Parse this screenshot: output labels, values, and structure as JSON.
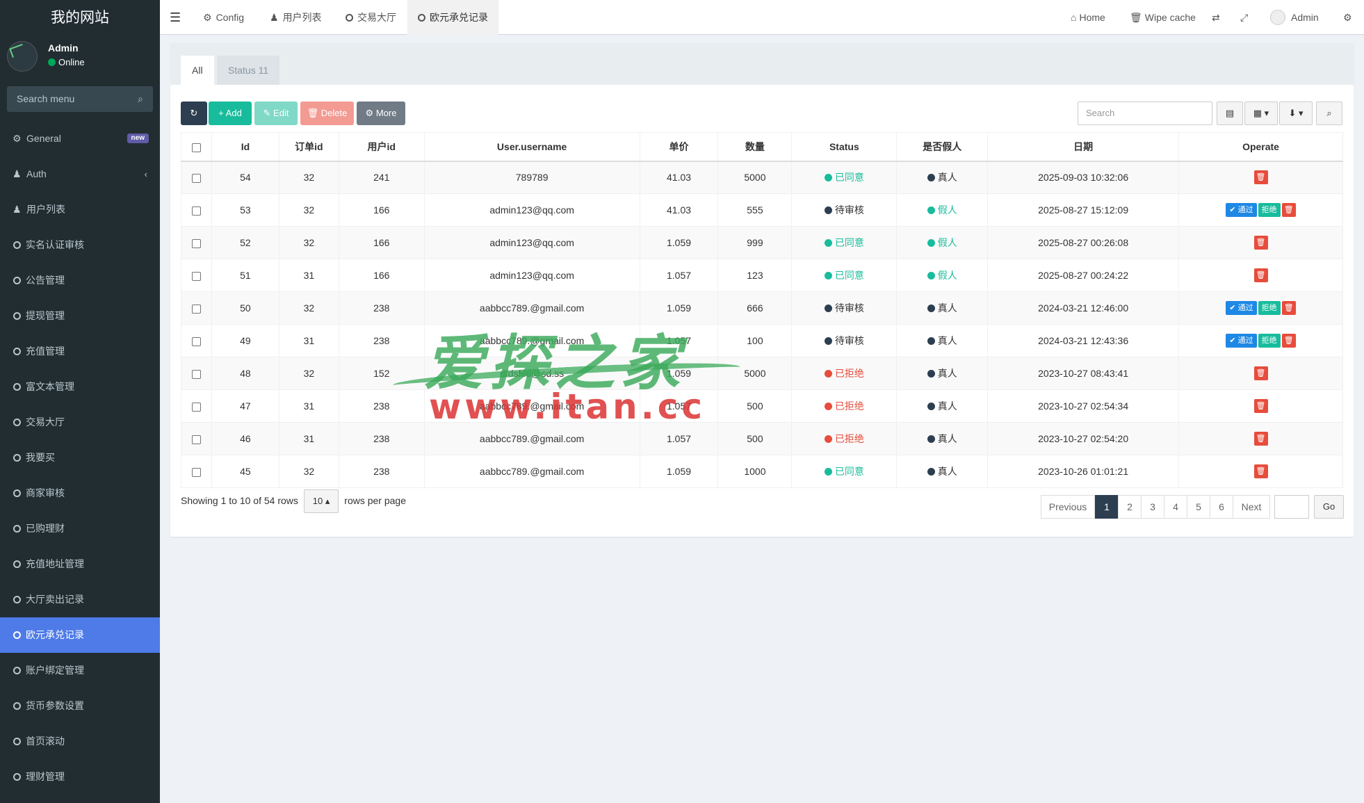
{
  "site_title": "我的网站",
  "user": {
    "name": "Admin",
    "status": "Online"
  },
  "sidebar": {
    "search_placeholder": "Search menu",
    "items": [
      {
        "label": "General",
        "icon": "cogs-icon",
        "badge": "new"
      },
      {
        "label": "Auth",
        "icon": "group-icon"
      },
      {
        "label": "用户列表",
        "icon": "user-icon"
      },
      {
        "label": "实名认证审核",
        "icon": "circle-icon"
      },
      {
        "label": "公告管理",
        "icon": "circle-icon"
      },
      {
        "label": "提现管理",
        "icon": "circle-icon"
      },
      {
        "label": "充值管理",
        "icon": "circle-icon"
      },
      {
        "label": "富文本管理",
        "icon": "circle-icon"
      },
      {
        "label": "交易大厅",
        "icon": "circle-icon"
      },
      {
        "label": "我要买",
        "icon": "circle-icon"
      },
      {
        "label": "商家审核",
        "icon": "circle-icon"
      },
      {
        "label": "已购理财",
        "icon": "circle-icon"
      },
      {
        "label": "充值地址管理",
        "icon": "circle-icon"
      },
      {
        "label": "大厅卖出记录",
        "icon": "circle-icon"
      },
      {
        "label": "欧元承兑记录",
        "icon": "circle-icon",
        "active": true
      },
      {
        "label": "账户绑定管理",
        "icon": "circle-icon"
      },
      {
        "label": "货币参数设置",
        "icon": "circle-icon"
      },
      {
        "label": "首页滚动",
        "icon": "circle-icon"
      },
      {
        "label": "理财管理",
        "icon": "circle-icon"
      }
    ]
  },
  "header": {
    "tabs": [
      {
        "label": "Config",
        "icon": "gear-icon"
      },
      {
        "label": "用户列表",
        "icon": "user-icon"
      },
      {
        "label": "交易大厅",
        "icon": "circle-icon"
      },
      {
        "label": "欧元承兑记录",
        "icon": "circle-icon",
        "active": true
      }
    ],
    "home": "Home",
    "wipe_cache": "Wipe cache",
    "admin": "Admin"
  },
  "panel_tabs": {
    "all": "All",
    "status": "Status 11"
  },
  "toolbar": {
    "add": "Add",
    "edit": "Edit",
    "delete": "Delete",
    "more": "More",
    "search_placeholder": "Search"
  },
  "table": {
    "columns": [
      "Id",
      "订单id",
      "用户id",
      "User.username",
      "单价",
      "数量",
      "Status",
      "是否假人",
      "日期",
      "Operate"
    ],
    "rows": [
      {
        "id": "54",
        "order": "32",
        "uid": "241",
        "username": "789789",
        "price": "41.03",
        "qty": "5000",
        "status": "已同意",
        "status_type": "green",
        "fake": "真人",
        "fake_type": "dark",
        "date": "2025-09-03 10:32:06",
        "ops": false
      },
      {
        "id": "53",
        "order": "32",
        "uid": "166",
        "username": "admin123@qq.com",
        "price": "41.03",
        "qty": "555",
        "status": "待审核",
        "status_type": "dark",
        "fake": "假人",
        "fake_type": "green",
        "date": "2025-08-27 15:12:09",
        "ops": true
      },
      {
        "id": "52",
        "order": "32",
        "uid": "166",
        "username": "admin123@qq.com",
        "price": "1.059",
        "qty": "999",
        "status": "已同意",
        "status_type": "green",
        "fake": "假人",
        "fake_type": "green",
        "date": "2025-08-27 00:26:08",
        "ops": false
      },
      {
        "id": "51",
        "order": "31",
        "uid": "166",
        "username": "admin123@qq.com",
        "price": "1.057",
        "qty": "123",
        "status": "已同意",
        "status_type": "green",
        "fake": "假人",
        "fake_type": "green",
        "date": "2025-08-27 00:24:22",
        "ops": false
      },
      {
        "id": "50",
        "order": "32",
        "uid": "238",
        "username": "aabbcc789.@gmail.com",
        "price": "1.059",
        "qty": "666",
        "status": "待审核",
        "status_type": "dark",
        "fake": "真人",
        "fake_type": "dark",
        "date": "2024-03-21 12:46:00",
        "ops": true
      },
      {
        "id": "49",
        "order": "31",
        "uid": "238",
        "username": "aabbcc789.@gmail.com",
        "price": "1.057",
        "qty": "100",
        "status": "待审核",
        "status_type": "dark",
        "fake": "真人",
        "fake_type": "dark",
        "date": "2024-03-21 12:43:36",
        "ops": true
      },
      {
        "id": "48",
        "order": "32",
        "uid": "152",
        "username": "dfdsfsd@sd.ss",
        "price": "1.059",
        "qty": "5000",
        "status": "已拒绝",
        "status_type": "red",
        "fake": "真人",
        "fake_type": "dark",
        "date": "2023-10-27 08:43:41",
        "ops": false
      },
      {
        "id": "47",
        "order": "31",
        "uid": "238",
        "username": "aabbcc789.@gmail.com",
        "price": "1.057",
        "qty": "500",
        "status": "已拒绝",
        "status_type": "red",
        "fake": "真人",
        "fake_type": "dark",
        "date": "2023-10-27 02:54:34",
        "ops": false
      },
      {
        "id": "46",
        "order": "31",
        "uid": "238",
        "username": "aabbcc789.@gmail.com",
        "price": "1.057",
        "qty": "500",
        "status": "已拒绝",
        "status_type": "red",
        "fake": "真人",
        "fake_type": "dark",
        "date": "2023-10-27 02:54:20",
        "ops": false
      },
      {
        "id": "45",
        "order": "32",
        "uid": "238",
        "username": "aabbcc789.@gmail.com",
        "price": "1.059",
        "qty": "1000",
        "status": "已同意",
        "status_type": "green",
        "fake": "真人",
        "fake_type": "dark",
        "date": "2023-10-26 01:01:21",
        "ops": false
      }
    ],
    "op_pass": "通过",
    "op_reject": "拒绝"
  },
  "footer": {
    "showing": "Showing 1 to 10 of 54 rows",
    "rows_per_page_value": "10",
    "rows_per_page_label": "rows per page",
    "pager": {
      "previous": "Previous",
      "pages": [
        "1",
        "2",
        "3",
        "4",
        "5",
        "6"
      ],
      "next": "Next",
      "go": "Go"
    }
  },
  "watermark": {
    "cn": "爱探之家",
    "url": "www.itan.cc"
  },
  "colors": {
    "sidebar_bg": "#222d32",
    "active_menu": "#4e7be8",
    "green": "#18bc9c",
    "red": "#e74c3c",
    "dark": "#2c3e50"
  }
}
